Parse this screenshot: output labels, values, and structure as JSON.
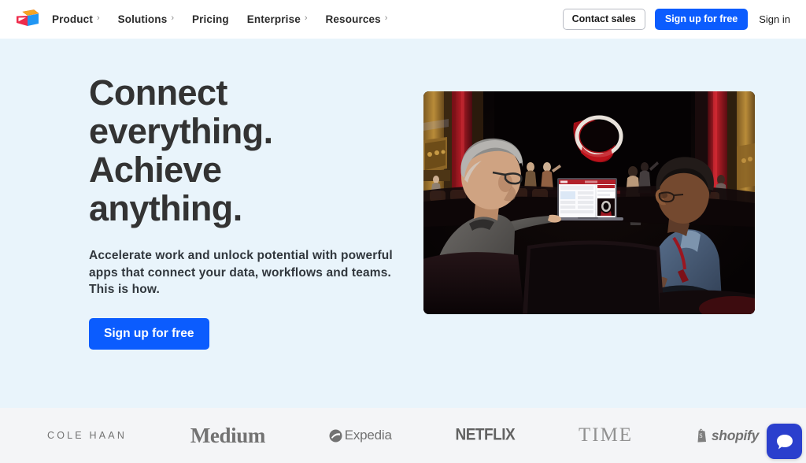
{
  "header": {
    "logo_name": "smartsheet-logo",
    "nav": [
      {
        "label": "Product",
        "chevron": "›",
        "has_chevron": true
      },
      {
        "label": "Solutions",
        "chevron": "›",
        "has_chevron": true
      },
      {
        "label": "Pricing",
        "chevron": "",
        "has_chevron": false
      },
      {
        "label": "Enterprise",
        "chevron": "›",
        "has_chevron": true
      },
      {
        "label": "Resources",
        "chevron": "›",
        "has_chevron": true
      }
    ],
    "contact_sales_label": "Contact sales",
    "signup_label": "Sign up for free",
    "signin_label": "Sign in"
  },
  "hero": {
    "headline_lines": [
      "Connect",
      "everything.",
      "Achieve",
      "anything."
    ],
    "headline_full": "Connect everything. Achieve anything.",
    "subheadline": "Accelerate work and unlock potential with powerful apps that connect your data, workflows and teams. This is how.",
    "cta_label": "Sign up for free",
    "image_alt": "Two colleagues seated in a dark ornate theater auditorium looking at a laptop showing a dashboard"
  },
  "logos": {
    "items": [
      {
        "name": "cole-haan",
        "label": "COLE HAAN"
      },
      {
        "name": "medium",
        "label": "Medium"
      },
      {
        "name": "expedia",
        "label": "Expedia"
      },
      {
        "name": "netflix",
        "label": "NETFLIX"
      },
      {
        "name": "time",
        "label": "TIME"
      },
      {
        "name": "shopify",
        "label": "shopify"
      }
    ]
  },
  "chat": {
    "icon": "chat-bubble-icon",
    "label": ""
  },
  "colors": {
    "accent_blue": "#0b5cfe",
    "hero_bg": "#e9f4fb",
    "logo_strip_bg": "#f4f5f7",
    "headline_text": "#333333",
    "chat_bg": "#2a3fcd"
  }
}
